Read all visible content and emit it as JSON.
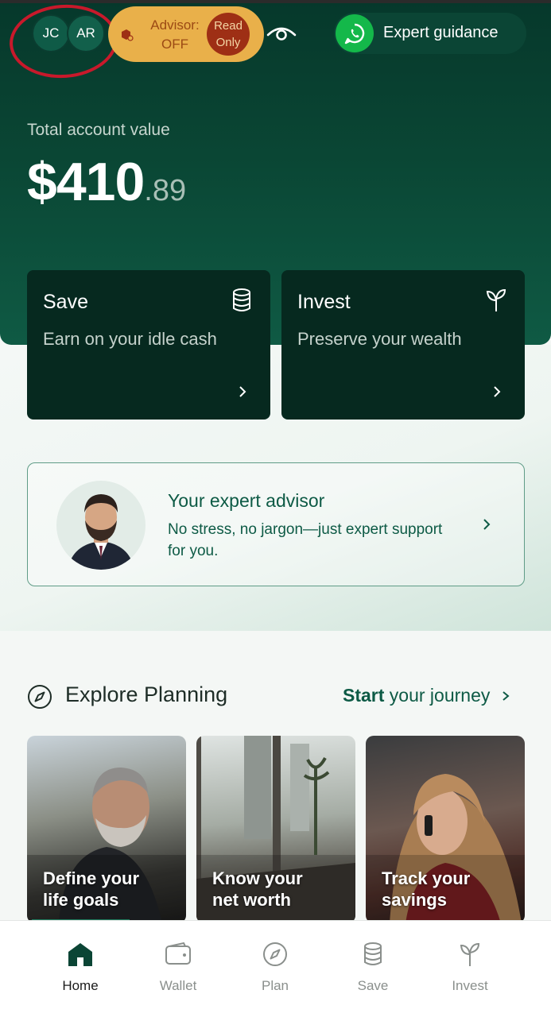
{
  "header": {
    "avatars": [
      "JC",
      "AR"
    ],
    "advisor_label": "Advisor:",
    "advisor_state": "OFF",
    "read_only_line1": "Read",
    "read_only_line2": "Only",
    "expert_guidance": "Expert guidance"
  },
  "account": {
    "label": "Total account value",
    "dollars": "$410",
    "cents": ".89"
  },
  "cards": [
    {
      "title": "Save",
      "subtitle": "Earn on your idle cash",
      "icon": "database-icon"
    },
    {
      "title": "Invest",
      "subtitle": "Preserve your wealth",
      "icon": "sprout-icon"
    }
  ],
  "advisor_card": {
    "title": "Your expert advisor",
    "subtitle": "No stress, no jargon—just expert support for you."
  },
  "explore": {
    "title": "Explore Planning",
    "link_bold": "Start",
    "link_rest": " your journey"
  },
  "tiles": [
    {
      "line1": "Define your",
      "line2": "life goals"
    },
    {
      "line1": "Know your",
      "line2": "net worth"
    },
    {
      "line1": "Track your",
      "line2": "savings"
    }
  ],
  "nav": [
    {
      "label": "Home",
      "icon": "home-icon",
      "active": true
    },
    {
      "label": "Wallet",
      "icon": "wallet-icon"
    },
    {
      "label": "Plan",
      "icon": "compass-icon"
    },
    {
      "label": "Save",
      "icon": "database-icon"
    },
    {
      "label": "Invest",
      "icon": "sprout-icon"
    }
  ],
  "colors": {
    "brand_dark": "#06382b",
    "card_dark": "#06291f",
    "advisor_pill": "#e9b04a",
    "read_only": "#9e2f15",
    "accent_green": "#0d5a45",
    "whatsapp": "#14b84a",
    "annotation_ring": "#c8192b"
  }
}
